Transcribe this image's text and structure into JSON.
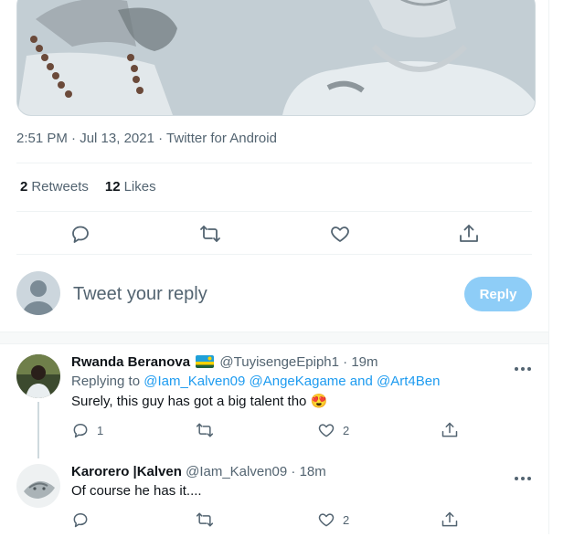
{
  "tweet": {
    "meta": {
      "time": "2:51 PM",
      "date": "Jul 13, 2021",
      "source": "Twitter for Android"
    },
    "stats": {
      "retweets_count": "2",
      "retweets_label": "Retweets",
      "likes_count": "12",
      "likes_label": "Likes"
    }
  },
  "composer": {
    "placeholder": "Tweet your reply",
    "reply_button": "Reply"
  },
  "replies": [
    {
      "name": "Rwanda Beranova",
      "flag": "rwanda-flag",
      "handle": "@TuyisengeEpiph1",
      "time": "19m",
      "replying_prefix": "Replying to",
      "replying_to": "@Iam_Kalven09 @AngeKagame and @Art4Ben",
      "text": "Surely, this guy has got a big talent tho",
      "emoji": "😍",
      "reply_count": "1",
      "retweet_count": "",
      "like_count": "2"
    },
    {
      "name": "Karorero |Kalven",
      "handle": "@Iam_Kalven09",
      "time": "18m",
      "text": "Of course  he has it....",
      "reply_count": "",
      "retweet_count": "",
      "like_count": "2"
    }
  ],
  "colors": {
    "accent": "#1d9bf0",
    "reply_button_disabled": "#8ecdf7",
    "secondary_text": "#536471"
  }
}
